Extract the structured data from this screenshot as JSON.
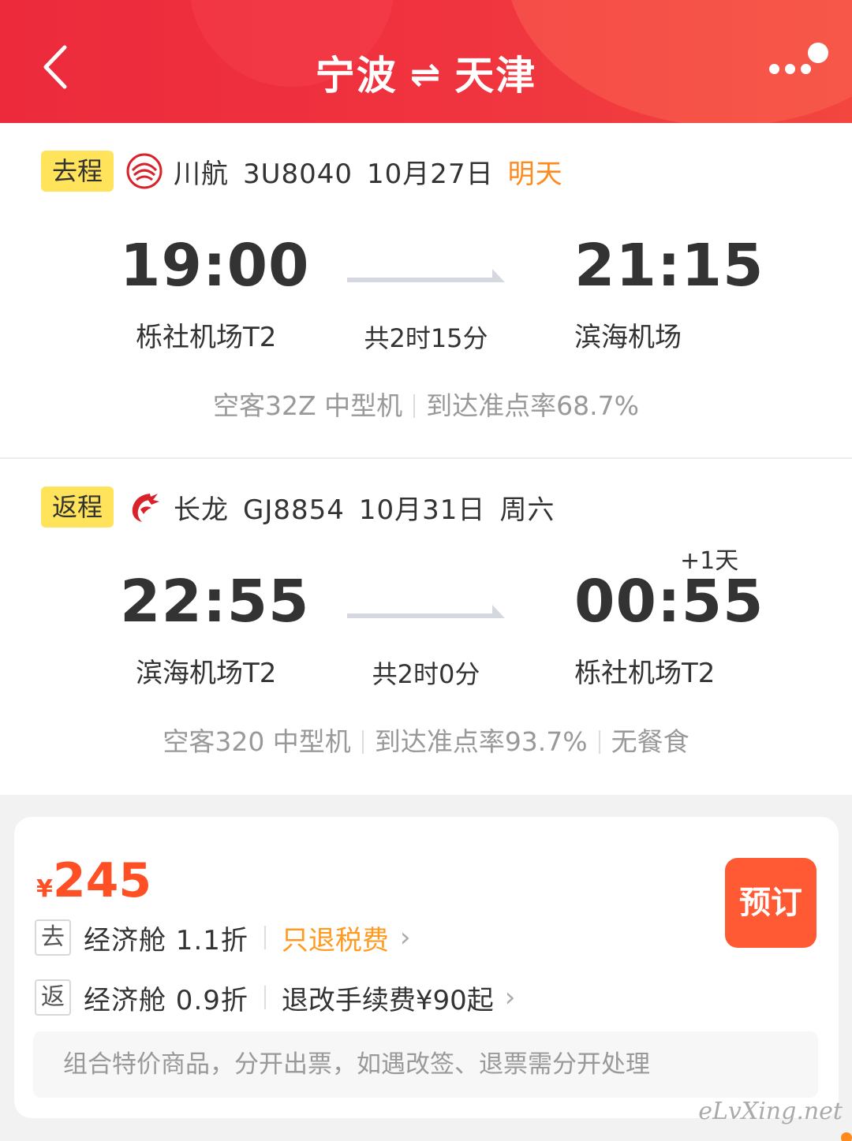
{
  "header": {
    "origin": "宁波",
    "swap_symbol": "⇌",
    "destination": "天津"
  },
  "outbound": {
    "tag": "去程",
    "airline": "川航",
    "flight_no": "3U8040",
    "date": "10月27日",
    "day_label": "明天",
    "dep_time": "19:00",
    "arr_time": "21:15",
    "dep_airport": "栎社机场T2",
    "arr_airport": "滨海机场",
    "duration": "共2时15分",
    "aircraft": "空客32Z 中型机",
    "on_time": "到达准点率68.7%"
  },
  "return": {
    "tag": "返程",
    "airline": "长龙",
    "flight_no": "GJ8854",
    "date": "10月31日",
    "day_label": "周六",
    "dep_time": "22:55",
    "arr_time": "00:55",
    "plus_day": "+1天",
    "dep_airport": "滨海机场T2",
    "arr_airport": "栎社机场T2",
    "duration": "共2时0分",
    "aircraft": "空客320 中型机",
    "on_time": "到达准点率93.7%",
    "meal": "无餐食"
  },
  "price_card": {
    "currency": "¥",
    "amount": "245",
    "book_label": "预订",
    "outbound_dir": "去",
    "outbound_cabin": "经济舱 1.1折",
    "outbound_policy": "只退税费",
    "return_dir": "返",
    "return_cabin": "经济舱 0.9折",
    "return_policy": "退改手续费¥90起",
    "notice": "组合特价商品，分开出票，如遇改签、退票需分开处理"
  },
  "watermark": "eLvXing.net",
  "colors": {
    "header_red": "#ec2a3c",
    "tag_yellow": "#ffe35a",
    "price_orange": "#ff4f24",
    "book_button": "#ff5a33",
    "highlight_orange": "#ff8a1d"
  }
}
